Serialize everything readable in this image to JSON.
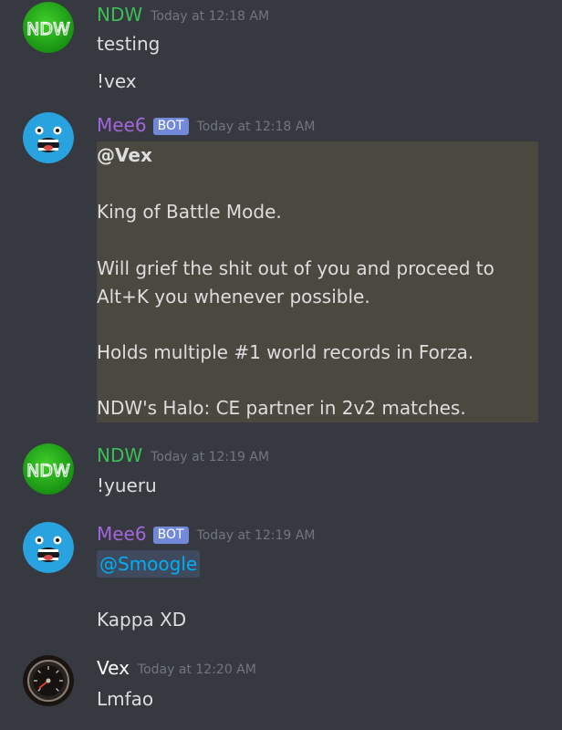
{
  "colors": {
    "background": "#36393f",
    "ndw_name": "#3bbf54",
    "mee6_name": "#a466d8",
    "vex_name": "#ffffff",
    "bot_tag": "#7289da",
    "timestamp": "#72767d",
    "message_text": "#dcddde",
    "highlight_block": "#4b4840",
    "mention": "#00b0f4"
  },
  "messages": [
    {
      "author": "NDW",
      "avatar_text": "NDW",
      "timestamp": "Today at 12:18 AM",
      "lines": [
        "testing",
        "!vex"
      ]
    },
    {
      "author": "Mee6",
      "bot_tag": "BOT",
      "timestamp": "Today at 12:18 AM",
      "mention": "@Vex",
      "lines": [
        "King of Battle Mode.",
        "Will grief the shit out of you and proceed to",
        "Alt+K you whenever possible.",
        "Holds multiple #1 world records in Forza.",
        "NDW's Halo: CE partner in 2v2 matches."
      ]
    },
    {
      "author": "NDW",
      "avatar_text": "NDW",
      "timestamp": "Today at 12:19 AM",
      "lines": [
        "!yueru"
      ]
    },
    {
      "author": "Mee6",
      "bot_tag": "BOT",
      "timestamp": "Today at 12:19 AM",
      "mention": "@Smoogle",
      "lines": [
        "Kappa XD"
      ]
    },
    {
      "author": "Vex",
      "timestamp": "Today at 12:20 AM",
      "lines": [
        "Lmfao"
      ]
    }
  ]
}
